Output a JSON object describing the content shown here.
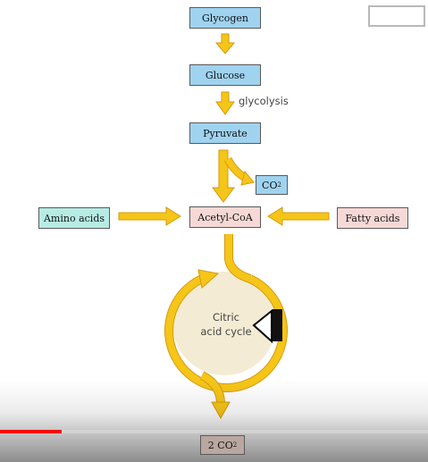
{
  "nodes": {
    "glycogen": "Glycogen",
    "glucose": "Glucose",
    "pyruvate": "Pyruvate",
    "co2_main": "CO",
    "co2_sub": "2",
    "acetyl_coa": "Acetyl-CoA",
    "amino_acids": "Amino acids",
    "fatty_acids": "Fatty acids",
    "cycle_line1": "Citric",
    "cycle_line2": "acid cycle",
    "out_co2_main": "2 CO",
    "out_co2_sub": "2"
  },
  "labels": {
    "glycolysis": "glycolysis"
  },
  "colors": {
    "arrow_fill": "#f5c518",
    "arrow_stroke": "#d89a0e",
    "blue_box": "#9fd3f0",
    "pink_box": "#f6d9d6",
    "teal_box": "#b6ece3",
    "cycle_fill": "#f3ebd3",
    "progress": "#ff0000"
  },
  "player": {
    "progress_fraction": 0.145
  }
}
